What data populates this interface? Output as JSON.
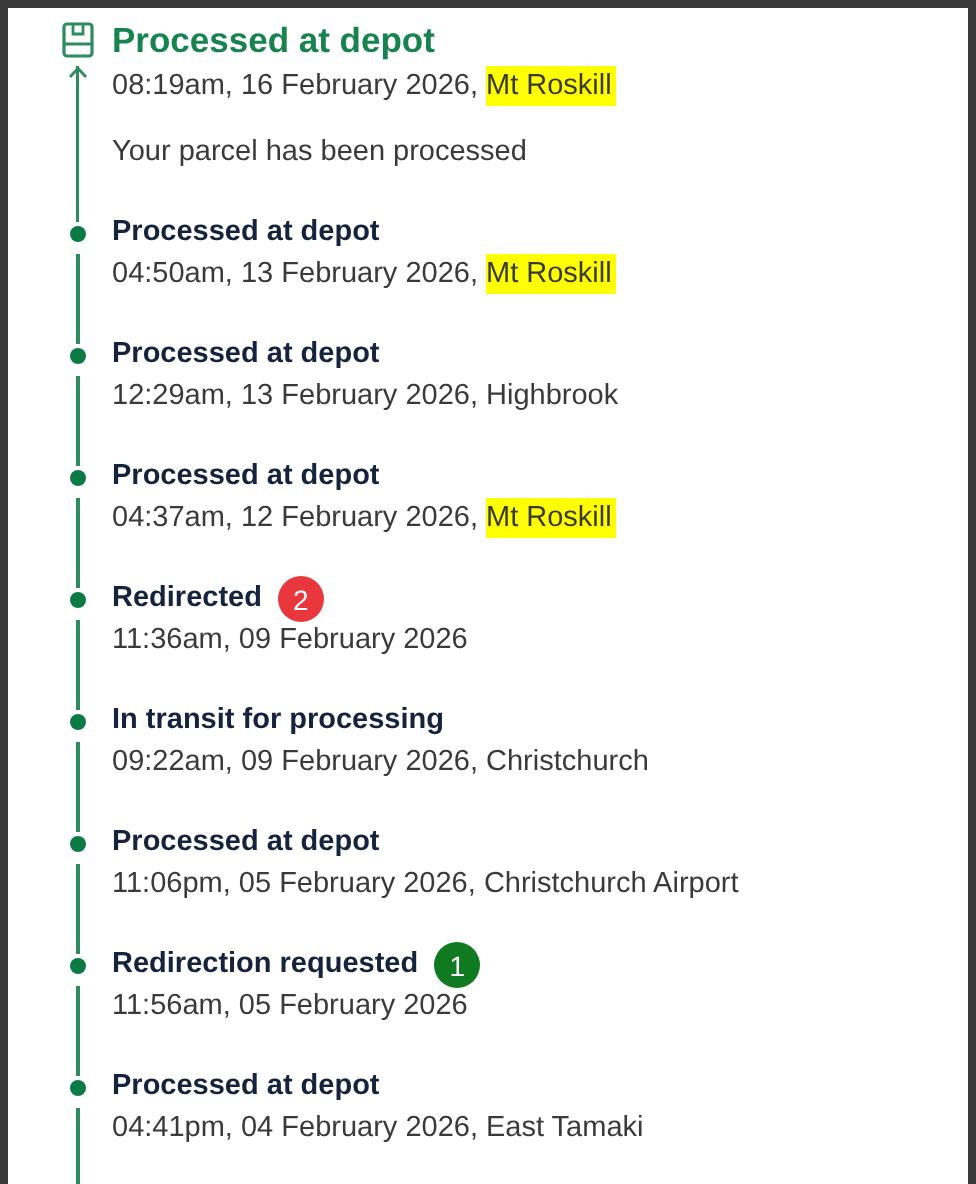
{
  "events": [
    {
      "title": "Processed at depot",
      "time": "08:19am, 16 February 2026, ",
      "location": "Mt Roskill",
      "highlighted": true,
      "description": "Your parcel has been processed",
      "current": true
    },
    {
      "title": "Processed at depot",
      "time": "04:50am, 13 February 2026, ",
      "location": "Mt Roskill",
      "highlighted": true,
      "current": false
    },
    {
      "title": "Processed at depot",
      "time": "12:29am, 13 February 2026, ",
      "location": "Highbrook",
      "highlighted": false,
      "current": false
    },
    {
      "title": "Processed at depot",
      "time": "04:37am, 12 February 2026, ",
      "location": "Mt Roskill",
      "highlighted": true,
      "current": false
    },
    {
      "title": "Redirected",
      "time": "11:36am, 09 February 2026",
      "marker": {
        "label": "2",
        "color": "#e8383d"
      },
      "current": false
    },
    {
      "title": "In transit for processing",
      "time": "09:22am, 09 February 2026, ",
      "location": "Christchurch",
      "highlighted": false,
      "current": false
    },
    {
      "title": "Processed at depot",
      "time": "11:06pm, 05 February 2026, ",
      "location": "Christchurch Airport",
      "highlighted": false,
      "current": false
    },
    {
      "title": "Redirection requested",
      "time": "11:56am, 05 February 2026",
      "marker": {
        "label": "1",
        "color": "#0f7a1f"
      },
      "current": false
    },
    {
      "title": "Processed at depot",
      "time": "04:41pm, 04 February 2026, ",
      "location": "East Tamaki",
      "highlighted": false,
      "current": false
    }
  ]
}
